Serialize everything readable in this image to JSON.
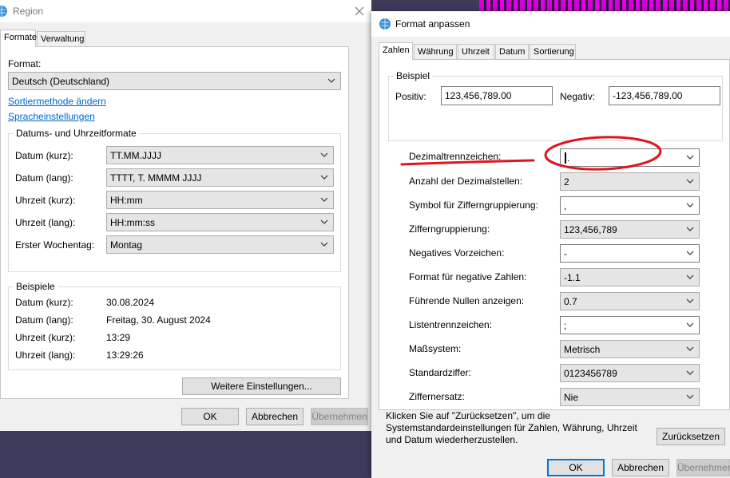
{
  "region": {
    "title": "Region",
    "tabs": [
      "Formate",
      "Verwaltung"
    ],
    "format_label": "Format:",
    "format_value": "Deutsch (Deutschland)",
    "links": [
      "Sortiermethode ändern",
      "Spracheinstellungen"
    ],
    "formats_group": {
      "title": "Datums- und Uhrzeitformate",
      "rows": [
        {
          "label": "Datum (kurz):",
          "value": "TT.MM.JJJJ"
        },
        {
          "label": "Datum (lang):",
          "value": "TTTT, T. MMMM JJJJ"
        },
        {
          "label": "Uhrzeit (kurz):",
          "value": "HH:mm"
        },
        {
          "label": "Uhrzeit (lang):",
          "value": "HH:mm:ss"
        },
        {
          "label": "Erster Wochentag:",
          "value": "Montag"
        }
      ]
    },
    "examples_group": {
      "title": "Beispiele",
      "rows": [
        {
          "label": "Datum (kurz):",
          "value": "30.08.2024"
        },
        {
          "label": "Datum (lang):",
          "value": "Freitag, 30. August 2024"
        },
        {
          "label": "Uhrzeit (kurz):",
          "value": "13:29"
        },
        {
          "label": "Uhrzeit (lang):",
          "value": "13:29:26"
        }
      ]
    },
    "more_settings": "Weitere Einstellungen...",
    "ok": "OK",
    "cancel": "Abbrechen",
    "apply": "Übernehmen"
  },
  "custom": {
    "title": "Format anpassen",
    "tabs": [
      "Zahlen",
      "Währung",
      "Uhrzeit",
      "Datum",
      "Sortierung"
    ],
    "example": {
      "title": "Beispiel",
      "positive_label": "Positiv:",
      "positive_value": "123,456,789.00",
      "negative_label": "Negativ:",
      "negative_value": "-123,456,789.00"
    },
    "settings": [
      {
        "label": "Dezimaltrennzeichen:",
        "value": ".",
        "editable": true
      },
      {
        "label": "Anzahl der Dezimalstellen:",
        "value": "2",
        "editable": false
      },
      {
        "label": "Symbol für Zifferngruppierung:",
        "value": ",",
        "editable": true
      },
      {
        "label": "Zifferngruppierung:",
        "value": "123,456,789",
        "editable": false
      },
      {
        "label": "Negatives Vorzeichen:",
        "value": "-",
        "editable": true
      },
      {
        "label": "Format für negative Zahlen:",
        "value": "-1.1",
        "editable": false
      },
      {
        "label": "Führende Nullen anzeigen:",
        "value": "0.7",
        "editable": false
      },
      {
        "label": "Listentrennzeichen:",
        "value": ";",
        "editable": true
      },
      {
        "label": "Maßsystem:",
        "value": "Metrisch",
        "editable": false
      },
      {
        "label": "Standardziffer:",
        "value": "0123456789",
        "editable": false
      },
      {
        "label": "Ziffernersatz:",
        "value": "Nie",
        "editable": false
      }
    ],
    "reset_hint": "Klicken Sie auf \"Zurücksetzen\", um die Systemstandardeinstellungen für Zahlen, Währung, Uhrzeit und Datum wiederherzustellen.",
    "reset_button": "Zurücksetzen",
    "ok": "OK",
    "cancel": "Abbrechen",
    "apply": "Übernehmen"
  },
  "colors": {
    "accent": "#0078d7",
    "annotation_red": "#e0141e",
    "link": "#0066cc",
    "desktop": "#3d3a5c"
  },
  "icons": [
    "globe-clock-icon",
    "close-icon",
    "chevron-down-icon"
  ]
}
